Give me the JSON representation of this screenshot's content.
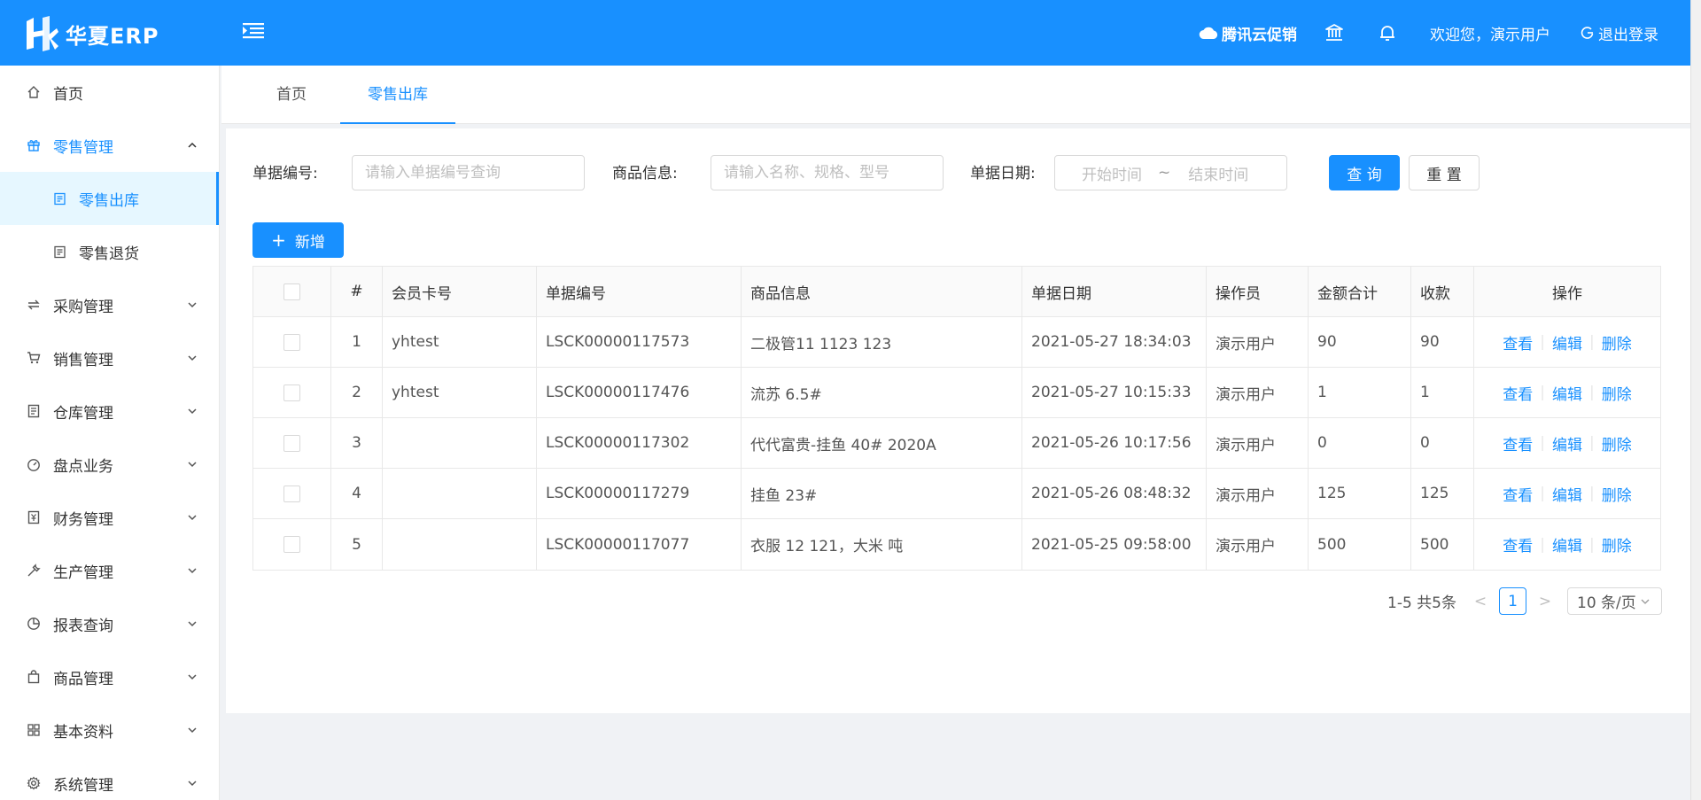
{
  "app": {
    "name": "华夏ERP"
  },
  "header": {
    "promo_label": "腾讯云促销",
    "welcome": "欢迎您，演示用户",
    "logout_label": "退出登录",
    "accent": "#1890ff"
  },
  "sidebar": {
    "items": [
      {
        "label": "首页",
        "icon": "home-icon"
      },
      {
        "label": "零售管理",
        "icon": "gift-icon",
        "expanded": true,
        "children": [
          {
            "label": "零售出库",
            "active": true
          },
          {
            "label": "零售退货"
          }
        ]
      },
      {
        "label": "采购管理",
        "icon": "swap-icon"
      },
      {
        "label": "销售管理",
        "icon": "cart-icon"
      },
      {
        "label": "仓库管理",
        "icon": "warehouse-icon"
      },
      {
        "label": "盘点业务",
        "icon": "dashboard-icon"
      },
      {
        "label": "财务管理",
        "icon": "finance-icon"
      },
      {
        "label": "生产管理",
        "icon": "tool-icon"
      },
      {
        "label": "报表查询",
        "icon": "pie-chart-icon"
      },
      {
        "label": "商品管理",
        "icon": "shopping-bag-icon"
      },
      {
        "label": "基本资料",
        "icon": "appstore-icon"
      },
      {
        "label": "系统管理",
        "icon": "setting-icon"
      }
    ]
  },
  "tabs": [
    {
      "label": "首页"
    },
    {
      "label": "零售出库",
      "active": true
    }
  ],
  "filters": {
    "number_label": "单据编号:",
    "number_placeholder": "请输入单据编号查询",
    "goods_label": "商品信息:",
    "goods_placeholder": "请输入名称、规格、型号",
    "date_label": "单据日期:",
    "date_start_placeholder": "开始时间",
    "date_sep": "~",
    "date_end_placeholder": "结束时间",
    "query_label": "查 询",
    "reset_label": "重 置"
  },
  "add_label": "新增",
  "table": {
    "columns": [
      "#",
      "会员卡号",
      "单据编号",
      "商品信息",
      "单据日期",
      "操作员",
      "金额合计",
      "收款",
      "操作"
    ],
    "rows": [
      {
        "index": "1",
        "member": "yhtest",
        "number": "LSCK00000117573",
        "goods": "二极管11 1123 123",
        "date": "2021-05-27 18:34:03",
        "operator": "演示用户",
        "amount": "90",
        "received": "90"
      },
      {
        "index": "2",
        "member": "yhtest",
        "number": "LSCK00000117476",
        "goods": "流苏 6.5#",
        "date": "2021-05-27 10:15:33",
        "operator": "演示用户",
        "amount": "1",
        "received": "1"
      },
      {
        "index": "3",
        "member": "",
        "number": "LSCK00000117302",
        "goods": "代代富贵-挂鱼 40# 2020A",
        "date": "2021-05-26 10:17:56",
        "operator": "演示用户",
        "amount": "0",
        "received": "0"
      },
      {
        "index": "4",
        "member": "",
        "number": "LSCK00000117279",
        "goods": "挂鱼 23#",
        "date": "2021-05-26 08:48:32",
        "operator": "演示用户",
        "amount": "125",
        "received": "125"
      },
      {
        "index": "5",
        "member": "",
        "number": "LSCK00000117077",
        "goods": "衣服 12 121，大米 吨",
        "date": "2021-05-25 09:58:00",
        "operator": "演示用户",
        "amount": "500",
        "received": "500"
      }
    ],
    "actions": [
      "查看",
      "编辑",
      "删除"
    ],
    "action_sep": "|"
  },
  "pagination": {
    "summary": "1-5 共5条",
    "current_page": "1",
    "page_size": "10 条/页",
    "prev": "<",
    "next": ">"
  }
}
